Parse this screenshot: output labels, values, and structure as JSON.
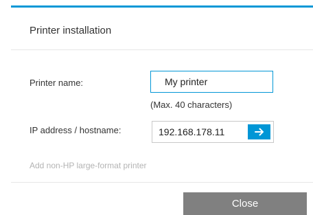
{
  "dialog": {
    "title": "Printer installation",
    "accent_color": "#0096d6"
  },
  "printer_name": {
    "label": "Printer name:",
    "value": "My printer",
    "hint": "(Max. 40 characters)"
  },
  "ip_address": {
    "label": "IP address / hostname:",
    "value": "192.168.178.11",
    "go_icon": "arrow-right-icon"
  },
  "add_printer_link": "Add non-HP large-format printer",
  "footer": {
    "close_label": "Close"
  }
}
